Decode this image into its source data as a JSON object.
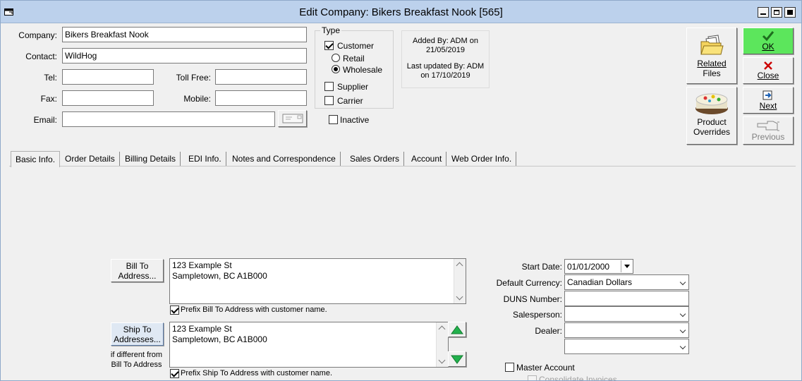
{
  "window": {
    "title": "Edit Company: Bikers Breakfast Nook [565]"
  },
  "fields": {
    "company_label": "Company:",
    "company_value": "Bikers Breakfast Nook",
    "contact_label": "Contact:",
    "contact_value": "WildHog",
    "tel_label": "Tel:",
    "tel_value": "",
    "tollfree_label": "Toll Free:",
    "tollfree_value": "",
    "fax_label": "Fax:",
    "fax_value": "",
    "mobile_label": "Mobile:",
    "mobile_value": "",
    "email_label": "Email:",
    "email_value": ""
  },
  "type_group": {
    "label": "Type",
    "customer": "Customer",
    "retail": "Retail",
    "wholesale": "Wholesale",
    "supplier": "Supplier",
    "carrier": "Carrier",
    "inactive": "Inactive"
  },
  "audit": {
    "added_line1": "Added By: ADM on",
    "added_line2": "21/05/2019",
    "updated_line1": "Last updated By: ADM",
    "updated_line2": "on 17/10/2019"
  },
  "actions": {
    "related_line1": "Related",
    "related_line2": "Files",
    "ok": "OK",
    "close": "Close",
    "overrides_line1": "Product",
    "overrides_line2": "Overrides",
    "next": "Next",
    "previous": "Previous"
  },
  "tabs": [
    "Basic Info.",
    "Order Details",
    "Billing Details",
    "EDI Info.",
    "Notes and Correspondence",
    "Sales Orders",
    "Account",
    "Web Order Info."
  ],
  "bill_to": {
    "button_line1": "Bill To",
    "button_line2": "Address...",
    "address_line1": "123 Example St",
    "address_line2": "Sampletown, BC  A1B000",
    "prefix_label": "Prefix Bill To Address with customer name."
  },
  "ship_to": {
    "button_line1": "Ship To",
    "button_line2": "Addresses...",
    "note_line1": "if different from",
    "note_line2": "Bill To Address",
    "address_line1": "123 Example St",
    "address_line2": "Sampletown, BC  A1B000",
    "prefix_label": "Prefix Ship To Address with customer name."
  },
  "right_panel": {
    "start_date_label": "Start Date:",
    "start_date_value": "01/01/2000",
    "currency_label": "Default Currency:",
    "currency_value": "Canadian Dollars",
    "duns_label": "DUNS Number:",
    "duns_value": "",
    "salesperson_label": "Salesperson:",
    "salesperson_value": "",
    "dealer_label": "Dealer:",
    "dealer_value": "",
    "extra_value": "",
    "master_account": "Master Account",
    "consolidate_invoices": "Consolidate Invoices"
  },
  "colors": {
    "titlebar": "#bcd1ec",
    "ok_button": "#5ce65c",
    "arrow_green": "#22b14c",
    "close_x": "#cc0000"
  }
}
